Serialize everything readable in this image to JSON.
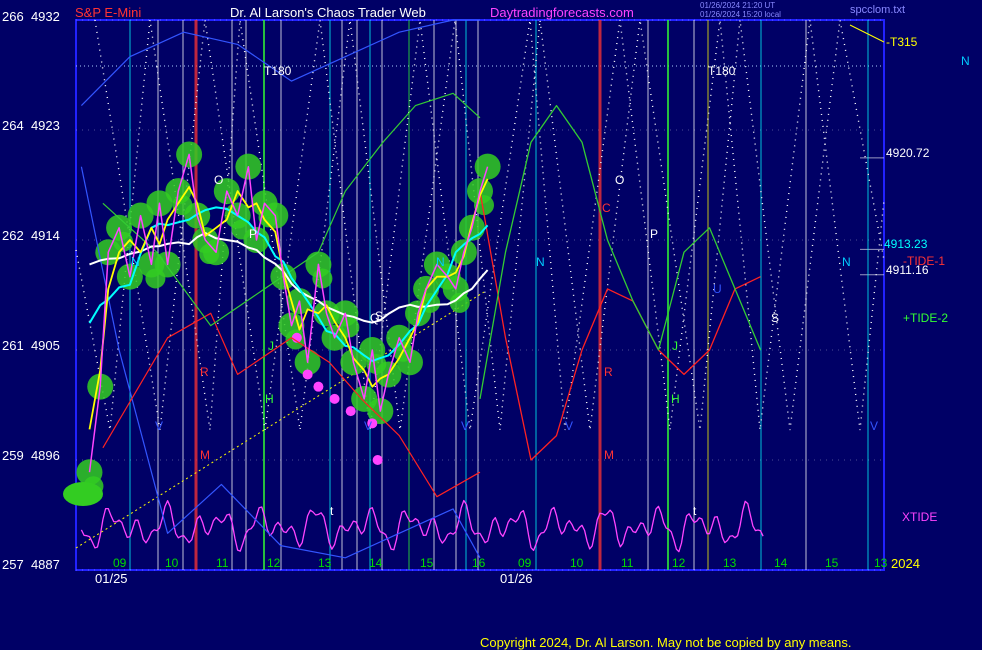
{
  "header": {
    "symbol": "S&P E-Mini",
    "title": "Dr. Al Larson's Chaos Trader Web",
    "site": "Daytradingforecasts.com",
    "timestamp1": "01/26/2024 21:20 UT",
    "timestamp2": "01/26/2024 15:20 local",
    "file": "spcclom.txt"
  },
  "copyright": "Copyright 2024, Dr. Al Larson. May not be copied by any means.",
  "y_axis_labels": [
    {
      "deg": "266",
      "price": "4932"
    },
    {
      "deg": "264",
      "price": "4923"
    },
    {
      "deg": "262",
      "price": "4914"
    },
    {
      "deg": "261",
      "price": "4905"
    },
    {
      "deg": "259",
      "price": "4896"
    },
    {
      "deg": "257",
      "price": "4887"
    }
  ],
  "right_labels": [
    {
      "text": "-T315",
      "color": "#ffff00"
    },
    {
      "text": "N",
      "color": "#00ccff"
    },
    {
      "text": "4920.72",
      "color": "#ffffff"
    },
    {
      "text": "4913.23",
      "color": "#00ffff"
    },
    {
      "text": "-TIDE-1",
      "color": "#ff3333"
    },
    {
      "text": "4911.16",
      "color": "#ffffff"
    },
    {
      "text": "+TIDE-2",
      "color": "#33ff33"
    },
    {
      "text": "XTIDE",
      "color": "#ff44ff"
    }
  ],
  "x_hours": [
    "09",
    "10",
    "11",
    "12",
    "13",
    "14",
    "15",
    "16",
    "09",
    "10",
    "11",
    "12",
    "13",
    "14",
    "15",
    "13"
  ],
  "x_year": "2024",
  "x_dates": [
    "01/25",
    "01/26"
  ],
  "chart_markers": [
    "T180",
    "T180",
    "N",
    "N",
    "N",
    "N",
    "O",
    "O",
    "P",
    "P",
    "Q",
    "R",
    "R",
    "M",
    "M",
    "J",
    "J",
    "H",
    "H",
    "V",
    "V",
    "V",
    "V",
    "V",
    "C",
    "S",
    "S",
    "t",
    "t",
    "U"
  ],
  "colors": {
    "background": "#000066",
    "price": "#ff44ff",
    "fast_ma": "#ffff00",
    "mid_ma": "#00ffff",
    "slow_ma": "#ffffff",
    "tide1": "#ff2222",
    "tide2": "#33cc33",
    "xtide": "#ff44ff",
    "halo": "#33cc22"
  },
  "chart_data": {
    "type": "line",
    "title": "S&P E-Mini",
    "yrange_price": [
      4887,
      4932
    ],
    "y_ticks_price": [
      4887,
      4896,
      4905,
      4914,
      4923,
      4932
    ],
    "y_ticks_deg": [
      257,
      259,
      261,
      262,
      264,
      266
    ],
    "x_ticks": [
      "09",
      "10",
      "11",
      "12",
      "13",
      "14",
      "15",
      "16",
      "09",
      "10",
      "11",
      "12",
      "13",
      "14",
      "15",
      "13"
    ],
    "dates": [
      "01/25",
      "01/26"
    ],
    "series": [
      {
        "name": "price",
        "values": [
          [
            8.75,
            4895
          ],
          [
            8.95,
            4902
          ],
          [
            9.1,
            4913
          ],
          [
            9.3,
            4915
          ],
          [
            9.5,
            4911
          ],
          [
            9.7,
            4916
          ],
          [
            9.9,
            4912
          ],
          [
            10.05,
            4917
          ],
          [
            10.2,
            4912
          ],
          [
            10.4,
            4918
          ],
          [
            10.6,
            4921
          ],
          [
            10.75,
            4916
          ],
          [
            10.9,
            4914
          ],
          [
            11.1,
            4913
          ],
          [
            11.3,
            4918
          ],
          [
            11.5,
            4916
          ],
          [
            11.7,
            4920
          ],
          [
            11.85,
            4914
          ],
          [
            12.0,
            4917
          ],
          [
            12.2,
            4916
          ],
          [
            12.35,
            4911
          ],
          [
            12.5,
            4907
          ],
          [
            12.65,
            4909
          ],
          [
            12.8,
            4904
          ],
          [
            13.0,
            4912
          ],
          [
            13.15,
            4908
          ],
          [
            13.3,
            4906
          ],
          [
            13.5,
            4908
          ],
          [
            13.65,
            4904
          ],
          [
            13.85,
            4901
          ],
          [
            14.0,
            4905
          ],
          [
            14.15,
            4900
          ],
          [
            14.3,
            4903
          ],
          [
            14.5,
            4906
          ],
          [
            14.7,
            4904
          ],
          [
            14.85,
            4908
          ],
          [
            15.0,
            4910
          ],
          [
            15.2,
            4912
          ],
          [
            15.4,
            4911
          ],
          [
            15.55,
            4910
          ],
          [
            15.7,
            4913
          ],
          [
            15.85,
            4915
          ],
          [
            16.0,
            4918
          ],
          [
            16.15,
            4920
          ]
        ]
      },
      {
        "name": "TIDE-1",
        "values": [
          [
            16.0,
            4918
          ],
          [
            16.5,
            4906
          ],
          [
            17.0,
            4896
          ],
          [
            17.5,
            4898
          ],
          [
            18.0,
            4905
          ],
          [
            18.5,
            4910
          ],
          [
            19.0,
            4909
          ],
          [
            19.5,
            4905
          ],
          [
            20.0,
            4903
          ],
          [
            20.5,
            4905
          ],
          [
            21.0,
            4910
          ],
          [
            21.5,
            4911
          ]
        ]
      },
      {
        "name": "TIDE-2",
        "values": [
          [
            16.0,
            4901
          ],
          [
            16.5,
            4913
          ],
          [
            17.0,
            4922
          ],
          [
            17.5,
            4925
          ],
          [
            18.0,
            4922
          ],
          [
            18.5,
            4914
          ],
          [
            19.0,
            4909
          ],
          [
            19.5,
            4905
          ],
          [
            20.0,
            4913
          ],
          [
            20.5,
            4915
          ],
          [
            21.0,
            4910
          ],
          [
            21.5,
            4905
          ]
        ]
      },
      {
        "name": "XTIDE",
        "values": [
          [
            9,
            4889
          ],
          [
            10,
            4890
          ],
          [
            11,
            4892
          ],
          [
            12,
            4891
          ],
          [
            13,
            4890
          ],
          [
            14,
            4889
          ],
          [
            15,
            4891
          ],
          [
            16,
            4889
          ],
          [
            17,
            4888
          ],
          [
            18,
            4890
          ],
          [
            19,
            4890
          ],
          [
            20,
            4888
          ],
          [
            21,
            4890
          ],
          [
            21.5,
            4890
          ]
        ]
      }
    ],
    "levels": [
      {
        "label": "4920.72",
        "value": 4920.72
      },
      {
        "label": "4913.23",
        "value": 4913.23
      },
      {
        "label": "4911.16",
        "value": 4911.16
      }
    ],
    "grid": true
  }
}
